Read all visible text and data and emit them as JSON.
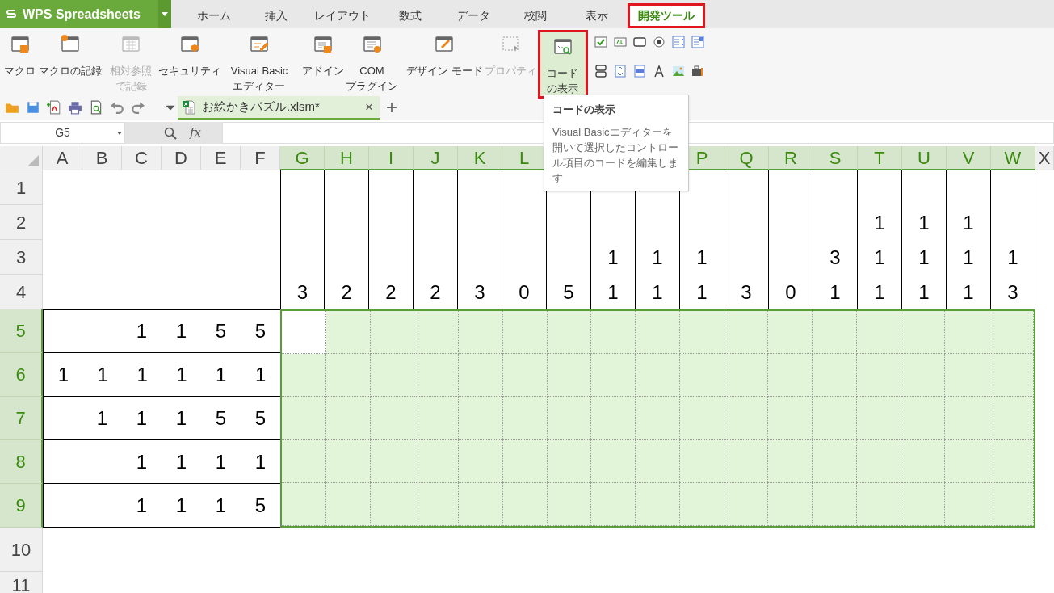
{
  "app_button": {
    "title": "WPS Spreadsheets"
  },
  "tabs": [
    {
      "label": "ホーム",
      "selected": false
    },
    {
      "label": "挿入",
      "selected": false
    },
    {
      "label": "レイアウト",
      "selected": false
    },
    {
      "label": "数式",
      "selected": false
    },
    {
      "label": "データ",
      "selected": false
    },
    {
      "label": "校閲",
      "selected": false
    },
    {
      "label": "表示",
      "selected": false
    },
    {
      "label": "開発ツール",
      "selected": true
    }
  ],
  "ribbon": {
    "buttons": [
      {
        "lines": [
          "マクロ"
        ],
        "disabled": false,
        "highlighted": false
      },
      {
        "lines": [
          "マクロの記録"
        ],
        "disabled": false,
        "highlighted": false
      },
      {
        "lines": [
          "相対参照",
          "で記録"
        ],
        "disabled": true,
        "highlighted": false
      },
      {
        "lines": [
          "セキュリティ"
        ],
        "disabled": false,
        "highlighted": false
      },
      {
        "lines": [
          "Visual Basic",
          "エディター"
        ],
        "disabled": false,
        "highlighted": false
      },
      {
        "lines": [
          "アドイン"
        ],
        "disabled": false,
        "highlighted": false
      },
      {
        "lines": [
          "COM",
          "プラグイン"
        ],
        "disabled": false,
        "highlighted": false
      },
      {
        "lines": [
          "デザイン モード"
        ],
        "disabled": false,
        "highlighted": false
      },
      {
        "lines": [
          "プロパティ"
        ],
        "disabled": true,
        "highlighted": false
      },
      {
        "lines": [
          "コード",
          "の表示"
        ],
        "disabled": false,
        "highlighted": true
      }
    ]
  },
  "document_tab": {
    "title": "お絵かきパズル.xlsm*",
    "close": "×",
    "new_tab": "+"
  },
  "formula_bar": {
    "name_box": "G5",
    "function_label": "fx"
  },
  "tooltip": {
    "title": "コードの表示",
    "body": "Visual Basicエディターを開いて選択したコントロール項目のコードを編集します"
  },
  "sheet": {
    "columns_left": [
      {
        "label": "A",
        "selected": false
      },
      {
        "label": "B",
        "selected": false
      },
      {
        "label": "C",
        "selected": false
      },
      {
        "label": "D",
        "selected": false
      },
      {
        "label": "E",
        "selected": false
      },
      {
        "label": "F",
        "selected": false
      },
      {
        "label": "G",
        "selected": true
      },
      {
        "label": "H",
        "selected": true
      },
      {
        "label": "I",
        "selected": true
      },
      {
        "label": "J",
        "selected": true
      },
      {
        "label": "K",
        "selected": true
      },
      {
        "label": "L",
        "selected": true
      }
    ],
    "columns_right": [
      {
        "label": "P",
        "selected": true
      },
      {
        "label": "Q",
        "selected": true
      },
      {
        "label": "R",
        "selected": true
      },
      {
        "label": "S",
        "selected": true
      },
      {
        "label": "T",
        "selected": true
      },
      {
        "label": "U",
        "selected": true
      },
      {
        "label": "V",
        "selected": true
      },
      {
        "label": "W",
        "selected": true
      },
      {
        "label": "X",
        "selected": false
      }
    ],
    "rows": [
      {
        "label": "1",
        "selected": false
      },
      {
        "label": "2",
        "selected": false
      },
      {
        "label": "3",
        "selected": false
      },
      {
        "label": "4",
        "selected": false
      },
      {
        "label": "5",
        "selected": true
      },
      {
        "label": "6",
        "selected": true
      },
      {
        "label": "7",
        "selected": true
      },
      {
        "label": "8",
        "selected": true
      },
      {
        "label": "9",
        "selected": true
      },
      {
        "label": "10",
        "selected": false
      },
      {
        "label": "11",
        "selected": false
      }
    ],
    "column_clues": [
      [
        "3"
      ],
      [
        "2"
      ],
      [
        "2"
      ],
      [
        "2"
      ],
      [
        "3"
      ],
      [
        "0"
      ],
      [
        "5"
      ],
      [
        "1",
        "1"
      ],
      [
        "1",
        "1"
      ],
      [
        "1",
        "1"
      ],
      [
        "3"
      ],
      [
        "0"
      ],
      [
        "3",
        "1"
      ],
      [
        "1",
        "1",
        "1"
      ],
      [
        "1",
        "1",
        "1"
      ],
      [
        "1",
        "1",
        "1"
      ],
      [
        "1",
        "3"
      ]
    ],
    "row_clues": [
      [
        "1",
        "1",
        "5",
        "5"
      ],
      [
        "1",
        "1",
        "1",
        "1",
        "1",
        "1"
      ],
      [
        "1",
        "1",
        "1",
        "5",
        "5"
      ],
      [
        "1",
        "1",
        "1",
        "1"
      ],
      [
        "1",
        "1",
        "1",
        "5"
      ]
    ]
  }
}
